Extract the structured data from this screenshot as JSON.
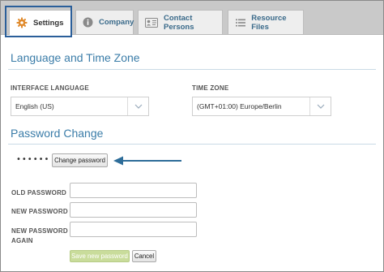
{
  "tabs": [
    {
      "label": "Settings",
      "icon": "gear-icon"
    },
    {
      "label": "Company",
      "icon": "info-icon"
    },
    {
      "label": "Contact Persons",
      "icon": "contact-card-icon"
    },
    {
      "label": "Resource Files",
      "icon": "list-icon"
    }
  ],
  "language_section": {
    "title": "Language and Time Zone",
    "interface_language_label": "INTERFACE LANGUAGE",
    "interface_language_value": "English (US)",
    "time_zone_label": "TIME ZONE",
    "time_zone_value": "(GMT+01:00) Europe/Berlin"
  },
  "password_section": {
    "title": "Password Change",
    "masked_password": "••••••",
    "change_button": "Change password",
    "old_label": "OLD PASSWORD",
    "new_label": "NEW PASSWORD",
    "again_label_line1": "NEW PASSWORD",
    "again_label_line2": "AGAIN",
    "save_button": "Save new password",
    "cancel_button": "Cancel"
  },
  "colors": {
    "accent_blue": "#3a7ca8",
    "highlight_border": "#2b5f9a",
    "gear_orange": "#e08a2c",
    "save_green": "#c9dc9b"
  }
}
